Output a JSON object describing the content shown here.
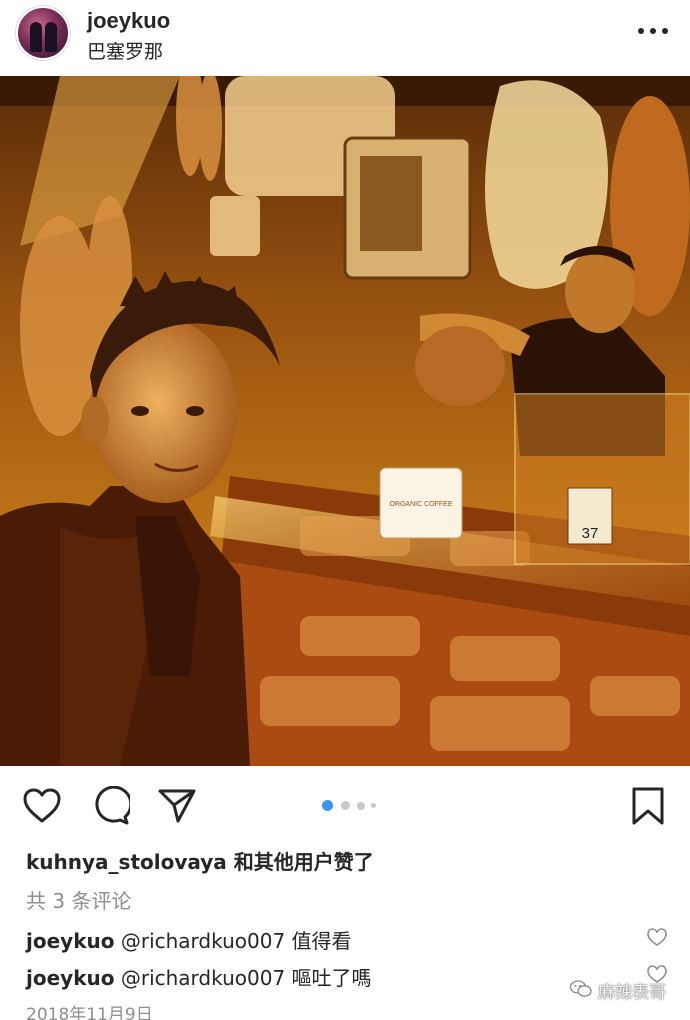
{
  "post": {
    "username": "joeykuo",
    "location": "巴塞罗那",
    "photo_alt": "joeykuo 在巴塞罗那市场肉铺前自拍"
  },
  "carousel": {
    "count": 4,
    "active_index": 0
  },
  "likes": {
    "user": "kuhnya_stolovaya",
    "suffix": " 和其他用户赞了"
  },
  "comments_count": "共 3 条评论",
  "comments": [
    {
      "user": "joeykuo",
      "mention": "@richardkuo007",
      "text": "值得看"
    },
    {
      "user": "joeykuo",
      "mention": "@richardkuo007",
      "text": "嘔吐了嗎"
    }
  ],
  "date": "2018年11月9日",
  "price_tag": "37",
  "cup_label": "ORGANIC COFFEE",
  "watermark": "麻辣表哥",
  "colors": {
    "text": "#262626",
    "muted": "#8e8e8e",
    "active_dot": "#3897f0",
    "inactive_dot": "#c8c8c8"
  }
}
